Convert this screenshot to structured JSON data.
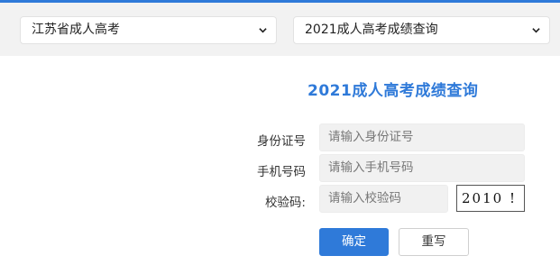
{
  "filters": {
    "province": {
      "selected": "江苏省成人高考"
    },
    "query_type": {
      "selected": "2021成人高考成绩查询"
    }
  },
  "form": {
    "title": "2021成人高考成绩查询",
    "fields": [
      {
        "label": "身份证号",
        "placeholder": "请输入身份证号"
      },
      {
        "label": "手机号码",
        "placeholder": "请输入手机号码"
      },
      {
        "label": "校验码:",
        "placeholder": "请输入校验码"
      }
    ],
    "captcha_text": "2010 !",
    "confirm_label": "确定",
    "reset_label": "重写"
  },
  "colors": {
    "accent": "#2f7ad9",
    "input_bg": "#f1f1f1",
    "bar_bg": "#f2f2f2"
  },
  "icons": {
    "select_arrow": "chevron-down-icon"
  }
}
